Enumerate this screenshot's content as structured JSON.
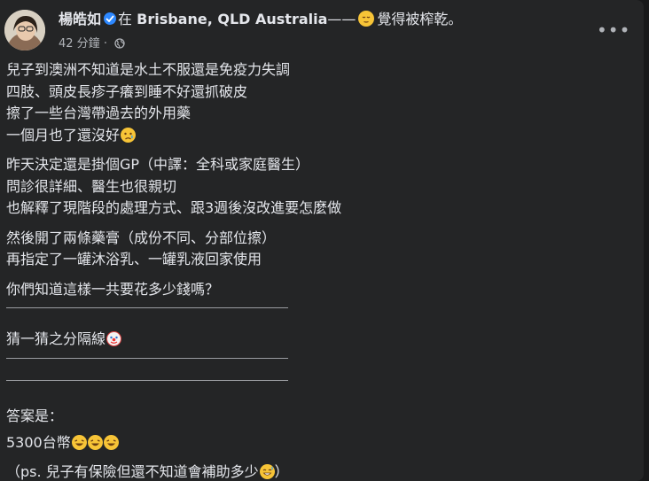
{
  "post": {
    "author": "楊皓如",
    "location_prefix": "在",
    "location": "Brisbane, QLD Australia",
    "feeling_dash": "——",
    "feeling_text": "覺得被榨乾。",
    "time": "42 分鐘",
    "time_separator": "·",
    "more_label": "•••"
  },
  "icons": {
    "verified": "verified-badge-icon",
    "globe": "globe-icon",
    "more": "more-options-icon"
  },
  "body": {
    "p1": [
      "兒子到澳洲不知道是水土不服還是免疫力失調",
      "四肢、頭皮長疹子癢到睡不好還抓破皮",
      "擦了一些台灣帶過去的外用藥",
      "一個月也了還沒好"
    ],
    "p2": [
      "昨天決定還是掛個GP（中譯：全科或家庭醫生）",
      "問診很詳細、醫生也很親切",
      "也解釋了現階段的處理方式、跟3週後沒改進要怎麼做"
    ],
    "p3": [
      "然後開了兩條藥膏（成份不同、分部位擦）",
      "再指定了一罐沐浴乳、一罐乳液回家使用"
    ],
    "question": "你們知道這樣一共要花多少錢嗎？",
    "guess_line": "猜一猜之分隔線",
    "answer_label": "答案是：",
    "answer_value": "5300台幣",
    "ps": "（ps. 兒子有保險但還不知道會補助多少"
  },
  "colors": {
    "background": "#242526",
    "text": "#e4e6eb",
    "secondary": "#b0b3b8",
    "verified": "#2d88ff"
  }
}
